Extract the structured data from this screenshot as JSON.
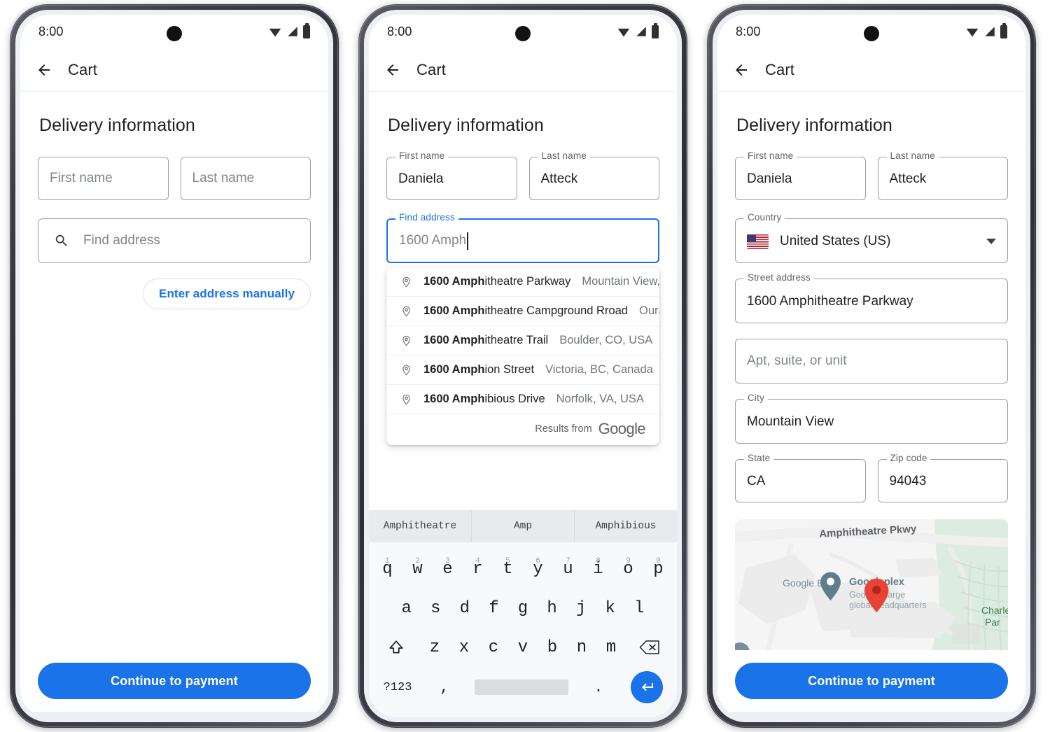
{
  "status_bar": {
    "time": "8:00",
    "wifi_icon": "wifi-icon",
    "signal_icon": "signal-icon",
    "battery_icon": "battery-icon",
    "camera_icon": "front-camera-punch-hole"
  },
  "app_bar": {
    "back_icon": "back-arrow-icon",
    "title": "Cart"
  },
  "section": {
    "title": "Delivery information"
  },
  "phone1": {
    "first_name": {
      "label": "First name",
      "placeholder": "First name",
      "value": ""
    },
    "last_name": {
      "label": "Last name",
      "placeholder": "Last name",
      "value": ""
    },
    "find_address": {
      "label": "Find address",
      "placeholder": "Find address",
      "value": "",
      "icon": "search-icon"
    },
    "manual_chip": "Enter address manually",
    "cta": "Continue to payment"
  },
  "phone2": {
    "first_name": {
      "label": "First name",
      "value": "Daniela"
    },
    "last_name": {
      "label": "Last name",
      "value": "Atteck"
    },
    "find_address": {
      "label": "Find address",
      "value": "1600 Amph"
    },
    "suggestions": [
      {
        "match": "1600 Amph",
        "rest": "itheatre Parkway",
        "sub": "Mountain View, C..."
      },
      {
        "match": "1600 Amph",
        "rest": "itheatre Campground Rroad",
        "sub": "Ouray, ..."
      },
      {
        "match": "1600 Amph",
        "rest": "itheatre Trail",
        "sub": "Boulder, CO, USA"
      },
      {
        "match": "1600 Amph",
        "rest": "ion Street",
        "sub": "Victoria, BC, Canada"
      },
      {
        "match": "1600 Amph",
        "rest": "ibious Drive",
        "sub": "Norfolk, VA, USA"
      }
    ],
    "results_from": "Results from",
    "google_wordmark": "Google",
    "keyboard": {
      "suggestions": [
        "Amphitheatre",
        "Amp",
        "Amphibious"
      ],
      "row1": [
        {
          "key": "q",
          "num": "1"
        },
        {
          "key": "w",
          "num": "2"
        },
        {
          "key": "e",
          "num": "3"
        },
        {
          "key": "r",
          "num": "4"
        },
        {
          "key": "t",
          "num": "5"
        },
        {
          "key": "y",
          "num": "6"
        },
        {
          "key": "u",
          "num": "7"
        },
        {
          "key": "i",
          "num": "8"
        },
        {
          "key": "o",
          "num": "9"
        },
        {
          "key": "p",
          "num": "0"
        }
      ],
      "row2": [
        "a",
        "s",
        "d",
        "f",
        "g",
        "h",
        "j",
        "k",
        "l"
      ],
      "row3": [
        "z",
        "x",
        "c",
        "v",
        "b",
        "n",
        "m"
      ],
      "shift_icon": "shift-key-icon",
      "backspace_icon": "backspace-key-icon",
      "numeric_key": "?123",
      "comma_key": ",",
      "period_key": ".",
      "space_key": "space-key",
      "enter_icon": "enter-key-icon"
    }
  },
  "phone3": {
    "first_name": {
      "label": "First name",
      "value": "Daniela"
    },
    "last_name": {
      "label": "Last name",
      "value": "Atteck"
    },
    "country": {
      "label": "Country",
      "value": "United States (US)",
      "flag": "us-flag-icon",
      "caret": "chevron-down-icon"
    },
    "street_address": {
      "label": "Street address",
      "value": "1600 Amphitheatre Parkway"
    },
    "apt": {
      "label": "",
      "placeholder": "Apt, suite, or unit",
      "value": ""
    },
    "city": {
      "label": "City",
      "value": "Mountain View"
    },
    "state": {
      "label": "State",
      "value": "CA"
    },
    "zip": {
      "label": "Zip code",
      "value": "94043"
    },
    "map": {
      "road_label": "Amphitheatre Pkwy",
      "poi_b40": "Google B40",
      "poi_googleplex": "Googleplex",
      "poi_googleplex_sub1": "Google's large",
      "poi_googleplex_sub2": "global headquarters",
      "park_label1": "Charle",
      "park_label2": "Par",
      "marker_icon": "map-pin-marker",
      "poi_pin_icon": "map-poi-pin"
    },
    "cta": "Continue to payment"
  },
  "colors": {
    "accent": "#1a73e8",
    "text_primary": "#202124",
    "text_secondary": "#5f6368",
    "placeholder": "#80868b",
    "border": "#9aa0a6",
    "marker_red": "#ea4335"
  }
}
